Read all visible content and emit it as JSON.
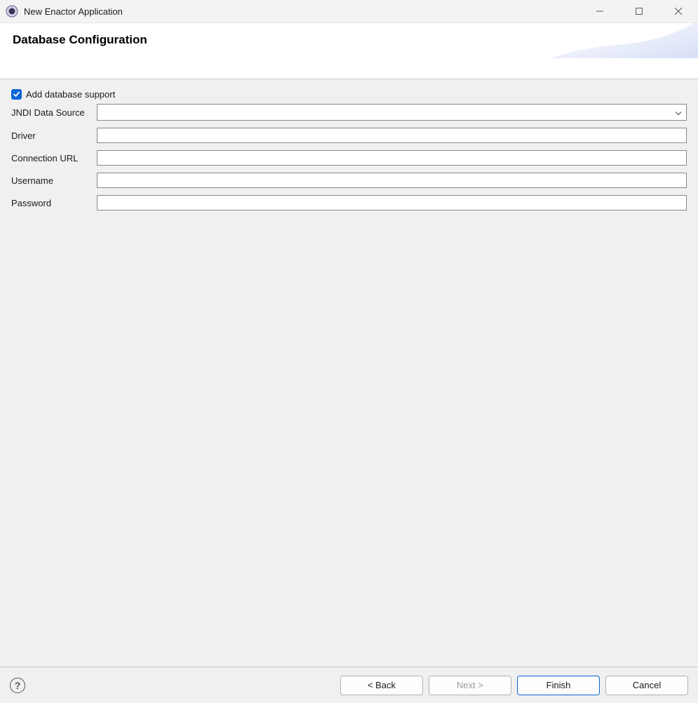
{
  "window": {
    "title": "New Enactor Application"
  },
  "header": {
    "title": "Database Configuration"
  },
  "form": {
    "checkbox_label": "Add database support",
    "checkbox_checked": true,
    "labels": {
      "jndi": "JNDI Data Source",
      "driver": "Driver",
      "url": "Connection URL",
      "username": "Username",
      "password": "Password"
    },
    "values": {
      "jndi": "",
      "driver": "",
      "url": "",
      "username": "",
      "password": ""
    }
  },
  "footer": {
    "help_tooltip": "Help",
    "back": "< Back",
    "next": "Next >",
    "finish": "Finish",
    "cancel": "Cancel"
  }
}
